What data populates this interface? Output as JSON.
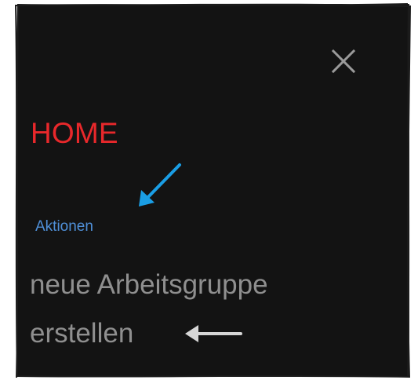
{
  "menu": {
    "close_icon": "close-icon",
    "home_label": "HOME",
    "section_label": "Aktionen",
    "action_item_label": "neue Arbeitsgruppe erstellen"
  },
  "colors": {
    "panel_background": "#131313",
    "home_text": "#e8282b",
    "section_text": "#4f8fd7",
    "item_text": "#8f8f8f",
    "close_icon": "#9a9a9a",
    "annotation_arrow_blue": "#1a9ee5",
    "annotation_arrow_grey": "#d6d6d6"
  }
}
